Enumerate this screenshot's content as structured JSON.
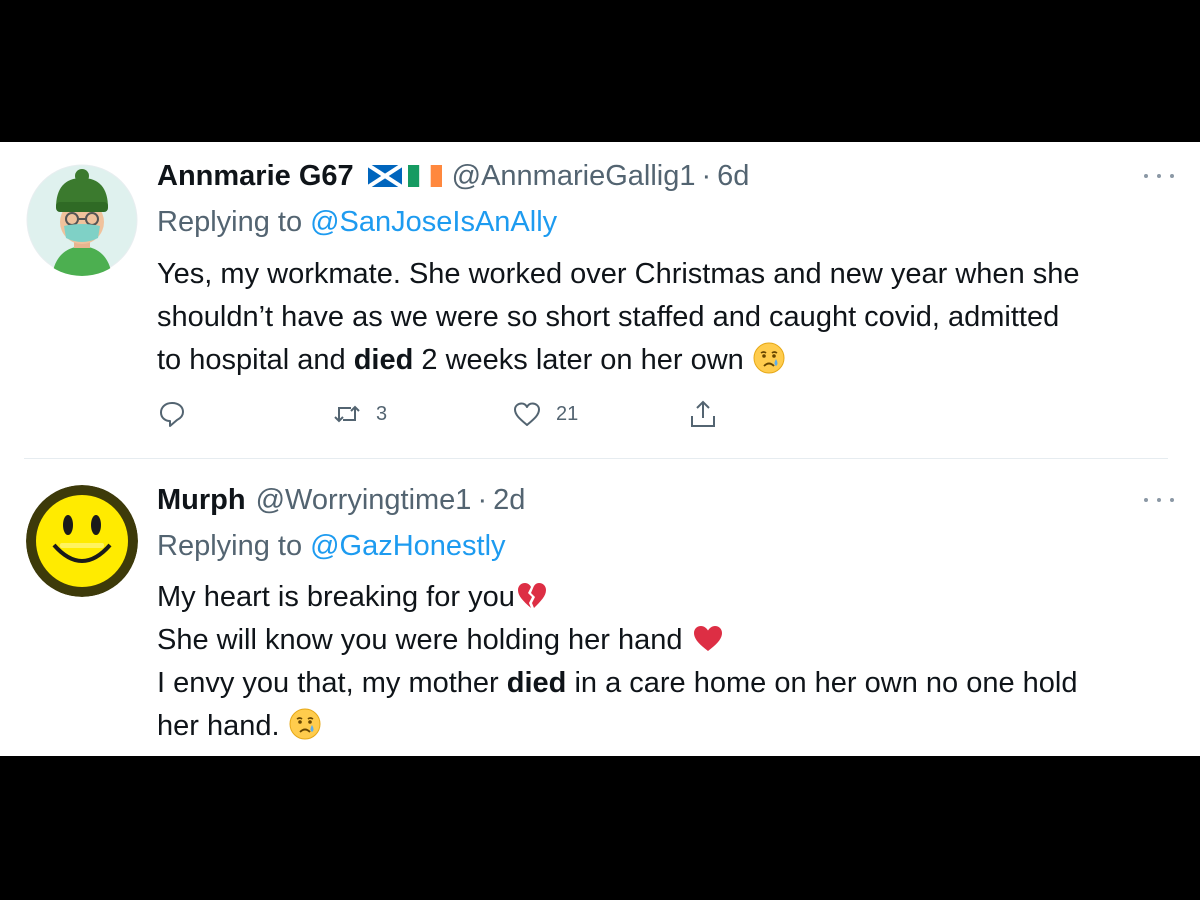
{
  "tweets": [
    {
      "author_name": "Annmarie G67",
      "handle": "@AnnmarieGallig1",
      "separator": "·",
      "age": "6d",
      "replying_label": "Replying to",
      "replying_to": "@SanJoseIsAnAlly",
      "body_lines": [
        "Yes, my workmate. She worked over Christmas and new year when she",
        "shouldn’t have as we were so short staffed and caught covid, admitted"
      ],
      "body_line3_before": "to hospital and ",
      "body_line3_bold": "died",
      "body_line3_after": " 2 weeks later on her own ",
      "retweet_count": "3",
      "like_count": "21",
      "icons": [
        "scotland-flag-icon",
        "ireland-flag-icon",
        "crying-face-emoji",
        "reply-icon",
        "retweet-icon",
        "like-icon",
        "share-icon",
        "more-icon"
      ]
    },
    {
      "author_name": "Murph",
      "handle": "@Worryingtime1",
      "separator": "·",
      "age": "2d",
      "replying_label": "Replying to",
      "replying_to": "@GazHonestly",
      "body_line1": "My heart is breaking for you",
      "body_line2": "She will know you were holding her hand ",
      "body_line3_before": "I envy you that, my mother ",
      "body_line3_bold": "died",
      "body_line3_after": " in a care home on her own no one hold",
      "body_line4": "her hand. ",
      "icons": [
        "broken-heart-emoji",
        "red-heart-emoji",
        "crying-face-emoji",
        "more-icon"
      ]
    }
  ],
  "colors": {
    "background": "#000000",
    "card": "#ffffff",
    "text_primary": "#0f1419",
    "text_secondary": "#536471",
    "link": "#1d9bf0",
    "divider": "#e6ecf0"
  }
}
